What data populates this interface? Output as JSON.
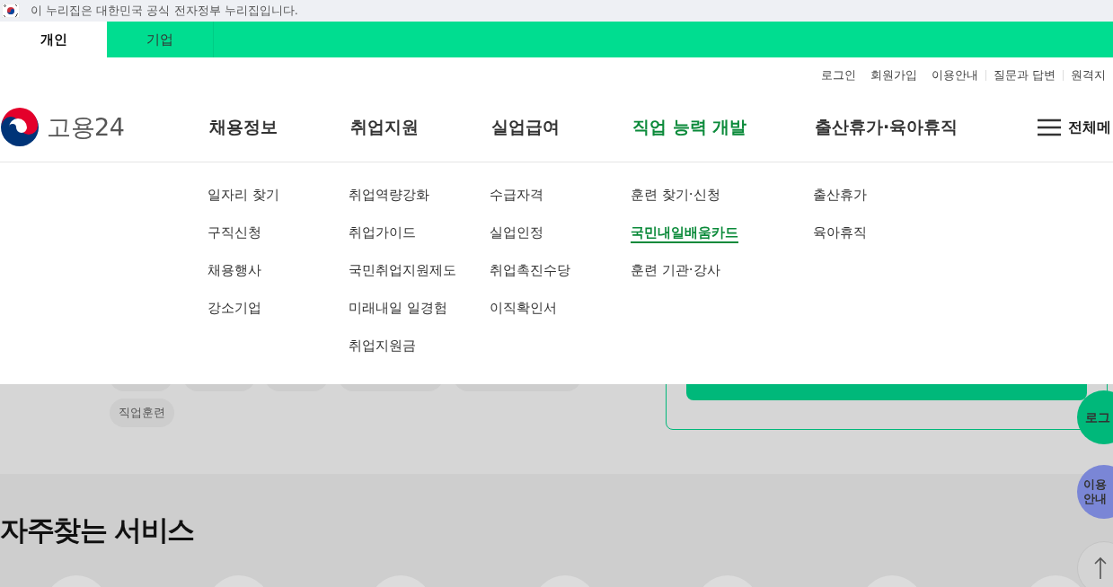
{
  "gov_banner": {
    "text": "이 누리집은 대한민국 공식 전자정부 누리집입니다."
  },
  "audience_tabs": [
    {
      "label": "개인",
      "selected": true
    },
    {
      "label": "기업",
      "selected": false
    }
  ],
  "utility_links": [
    "로그인",
    "회원가입",
    "이용안내",
    "질문과 답변",
    "원격지"
  ],
  "logo": {
    "text": "고용24"
  },
  "nav": [
    {
      "label": "채용정보",
      "selected": false,
      "children": [
        {
          "label": "일자리 찾기",
          "selected": false
        },
        {
          "label": "구직신청",
          "selected": false
        },
        {
          "label": "채용행사",
          "selected": false
        },
        {
          "label": "강소기업",
          "selected": false
        }
      ]
    },
    {
      "label": "취업지원",
      "selected": false,
      "children": [
        {
          "label": "취업역량강화",
          "selected": false
        },
        {
          "label": "취업가이드",
          "selected": false
        },
        {
          "label": "국민취업지원제도",
          "selected": false
        },
        {
          "label": "미래내일 일경험",
          "selected": false
        },
        {
          "label": "취업지원금",
          "selected": false
        }
      ]
    },
    {
      "label": "실업급여",
      "selected": false,
      "children": [
        {
          "label": "수급자격",
          "selected": false
        },
        {
          "label": "실업인정",
          "selected": false
        },
        {
          "label": "취업촉진수당",
          "selected": false
        },
        {
          "label": "이직확인서",
          "selected": false
        }
      ]
    },
    {
      "label": "직업 능력 개발",
      "selected": true,
      "children": [
        {
          "label": "훈련 찾기·신청",
          "selected": false
        },
        {
          "label": "국민내일배움카드",
          "selected": true
        },
        {
          "label": "훈련 기관·강사",
          "selected": false
        }
      ]
    },
    {
      "label": "출산휴가·육아휴직",
      "selected": false,
      "children": [
        {
          "label": "출산휴가",
          "selected": false
        },
        {
          "label": "육아휴직",
          "selected": false
        }
      ]
    }
  ],
  "all_menu": {
    "label": "전체메"
  },
  "chips": [
    "직업훈련"
  ],
  "section_title": "자주찾는 서비스",
  "floating_buttons": [
    {
      "kind": "login",
      "lines": [
        "로그"
      ]
    },
    {
      "kind": "guide",
      "lines": [
        "이용",
        "안내"
      ]
    },
    {
      "kind": "top"
    }
  ]
}
